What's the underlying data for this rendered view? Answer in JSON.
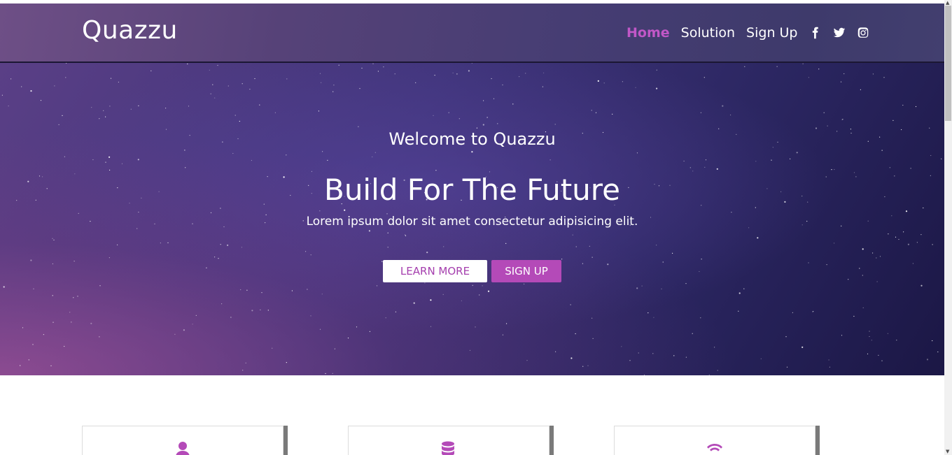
{
  "brand": "Quazzu",
  "nav": {
    "home": "Home",
    "solution": "Solution",
    "signup": "Sign Up",
    "social": [
      "facebook-icon",
      "twitter-icon",
      "instagram-icon"
    ]
  },
  "hero": {
    "subtitle": "Welcome to Quazzu",
    "title": "Build For The Future",
    "text": "Lorem ipsum dolor sit amet consectetur adipisicing elit.",
    "learn_more": "LEARN MORE",
    "sign_up": "SIGN UP"
  },
  "cards": [
    {
      "icon": "user-icon"
    },
    {
      "icon": "database-icon"
    },
    {
      "icon": "wifi-icon"
    }
  ],
  "colors": {
    "accent": "#b44ab8",
    "active_nav": "#c157c7",
    "header_bg": "#564278",
    "hero_bg": "#3f347a"
  }
}
